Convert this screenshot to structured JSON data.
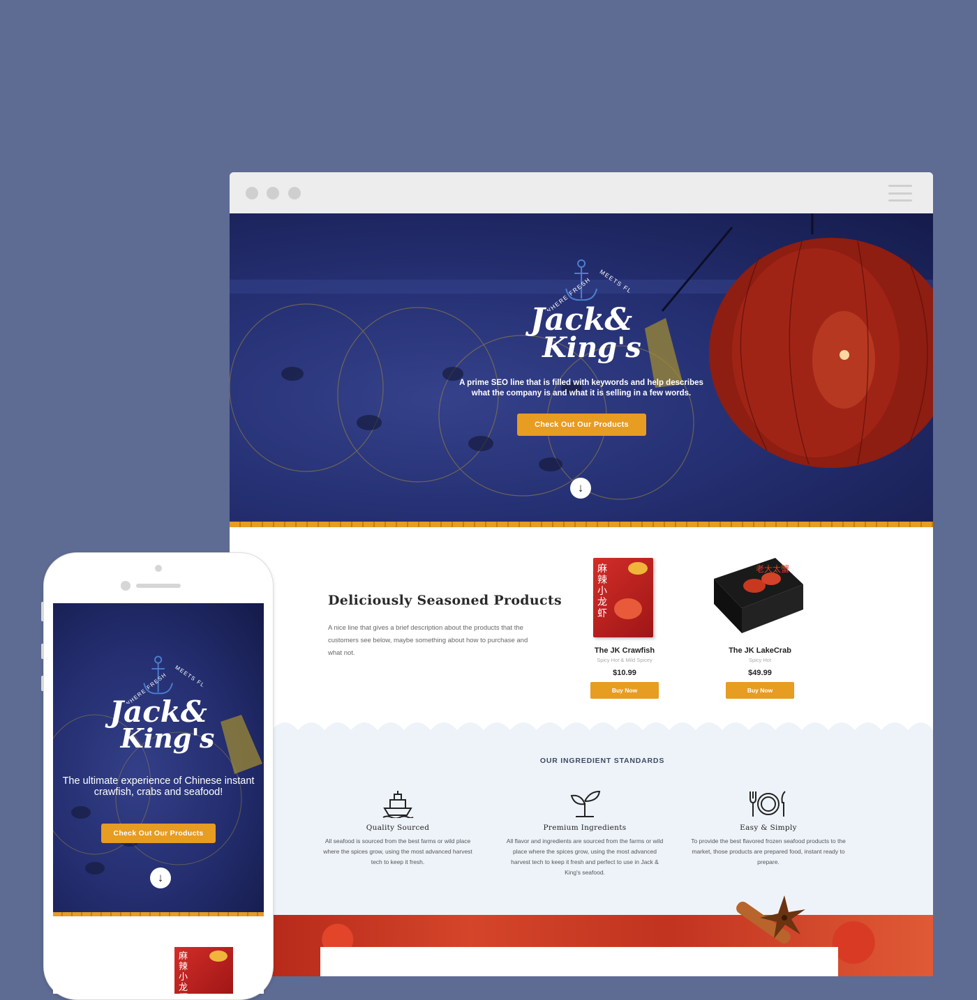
{
  "desktop": {
    "hero": {
      "logo_arc_left": "WHERE FRESH",
      "logo_arc_right": "MEETS FLAVOR",
      "logo_line1": "Jack&",
      "logo_line2": "King's",
      "tagline_line1": "A prime SEO line that is filled with keywords and help describes",
      "tagline_line2": "what the company is and what it is selling in a few words.",
      "cta_label": "Check Out Our Products",
      "scroll_glyph": "↓"
    },
    "products": {
      "title": "Deliciously Seasoned Products",
      "description": "A nice line that gives a brief description about the products that the customers see below, maybe something about how to purchase and what not.",
      "items": [
        {
          "name": "The JK Crawfish",
          "subtitle": "Spicy Hot & Mild Spicey",
          "price": "$10.99",
          "button": "Buy Now",
          "box_label": "麻辣小龙虾"
        },
        {
          "name": "The JK LakeCrab",
          "subtitle": "Spicy Hot",
          "price": "$49.99",
          "button": "Buy Now",
          "box_label": "老大太蟹"
        }
      ]
    },
    "standards": {
      "heading": "OUR INGREDIENT STANDARDS",
      "items": [
        {
          "title": "Quality Sourced",
          "text": "All seafood is sourced from the best farms or wild place where the spices grow, using the most advanced harvest tech to keep it fresh."
        },
        {
          "title": "Premium Ingredients",
          "text": "All flavor and ingredients are sourced from the farms or wild place where the spices grow, using the most advanced harvest tech to keep it fresh and perfect to use in Jack & King's seafood."
        },
        {
          "title": "Easy & Simply",
          "text": "To provide the best flavored frozen seafood products to the market, those products are prepared food, instant ready to prepare."
        }
      ]
    }
  },
  "mobile": {
    "logo_arc_left": "WHERE FRESH",
    "logo_arc_right": "MEETS FLAVOR",
    "logo_line1": "Jack&",
    "logo_line2": "King's",
    "tagline": "The ultimate experience of Chinese instant crawfish, crabs and seafood!",
    "cta_label": "Check Out Our Products",
    "scroll_glyph": "↓",
    "box_label": "麻辣小龙虾"
  },
  "colors": {
    "background": "#5e6b93",
    "accent": "#e79c22",
    "hero_navy": "#253073",
    "standards_bg": "#eef3f9"
  },
  "icons": [
    "menu-icon",
    "anchor-icon",
    "arrow-down-icon",
    "ship-icon",
    "sprout-icon",
    "dining-icon",
    "star-anise-icon"
  ]
}
